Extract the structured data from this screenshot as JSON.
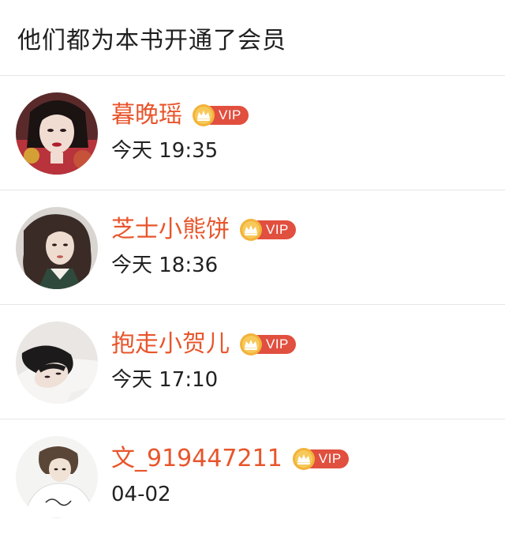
{
  "header": {
    "title": "他们都为本书开通了会员"
  },
  "members": [
    {
      "name": "暮晚瑶",
      "badge": "VIP",
      "time": "今天 19:35"
    },
    {
      "name": "芝士小熊饼",
      "badge": "VIP",
      "time": "今天 18:36"
    },
    {
      "name": "抱走小贺儿",
      "badge": "VIP",
      "time": "今天 17:10"
    },
    {
      "name": "文_919447211",
      "badge": "VIP",
      "time": "04-02"
    }
  ],
  "colors": {
    "name": "#e8552b",
    "vip_pill": "#e14f3f",
    "coin": "#f2b33a",
    "divider": "#e6e6e6"
  },
  "icons": [
    "crown-coin-icon"
  ]
}
